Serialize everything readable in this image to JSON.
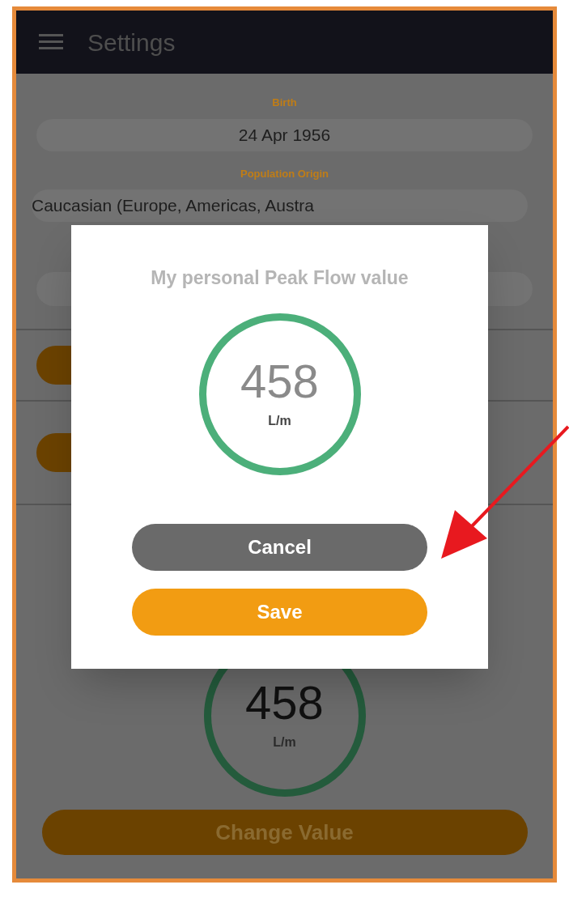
{
  "header": {
    "title": "Settings"
  },
  "form": {
    "fields": [
      {
        "label": "Birth",
        "value": "24 Apr 1956"
      },
      {
        "label": "Population Origin",
        "value": "Caucasian (Europe, Americas, Austra"
      }
    ],
    "peak_flow": {
      "value": "458",
      "unit": "L/m"
    },
    "change_button": "Change Value"
  },
  "dialog": {
    "title": "My personal Peak Flow value",
    "value": "458",
    "unit": "L/m",
    "buttons": [
      {
        "label": "Cancel",
        "kind": "secondary"
      },
      {
        "label": "Save",
        "kind": "primary"
      }
    ]
  }
}
